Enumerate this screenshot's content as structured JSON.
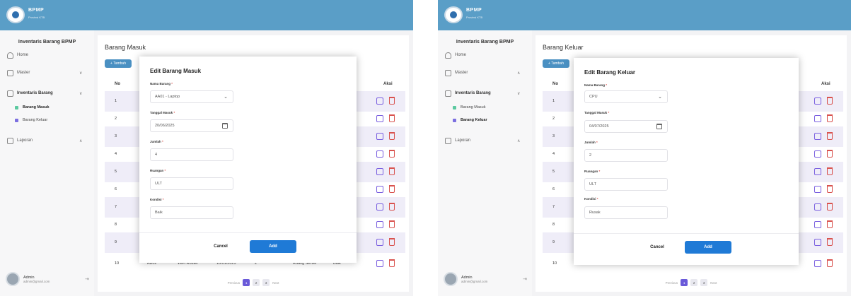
{
  "screens": [
    {
      "brand": "BPMP",
      "brand_sub": "Provinsi KTB",
      "sidebar": {
        "title": "Inventaris Barang BPMP",
        "home": "Home",
        "master": "Master",
        "master_chevron": "∨",
        "inventaris": "Inventaris Barang",
        "inventaris_chevron": "∨",
        "masuk": "Barang Masuk",
        "keluar": "Barang Keluar",
        "laporan": "Laporan",
        "laporan_chevron": "∧"
      },
      "user": {
        "name": "Admin",
        "email": "admin@gmail.com"
      },
      "main": {
        "page_title": "Barang Masuk",
        "add_label": "+ Tambah",
        "col_no": "No",
        "col_aksi": "Aksi",
        "rows": [
          "1",
          "2",
          "3",
          "4",
          "5",
          "6",
          "7",
          "8",
          "9",
          "10"
        ],
        "last_row": {
          "kode": "AB02",
          "nama": "WiFi Router",
          "tanggal": "10/01/2025",
          "jumlah": "2",
          "ruangan": "Ruang Server",
          "kondisi": "Baik"
        }
      },
      "pager": {
        "prev": "Previous",
        "pages": [
          "1",
          "2",
          "3"
        ],
        "next": "Next"
      },
      "modal": {
        "title": "Edit Barang Masuk",
        "nama_label": "Nama Barang",
        "nama_value": "AA01 - Laptop",
        "tanggal_label": "Tanggal Masuk",
        "tanggal_value": "20/06/2025",
        "jumlah_label": "Jumlah",
        "jumlah_value": "4",
        "ruangan_label": "Ruangan",
        "ruangan_value": "ULT",
        "kondisi_label": "Kondisi",
        "kondisi_value": "Baik",
        "cancel": "Cancel",
        "add": "Add"
      }
    },
    {
      "brand": "BPMP",
      "brand_sub": "Provinsi KTB",
      "sidebar": {
        "title": "Inventaris Barang BPMP",
        "home": "Home",
        "master": "Master",
        "master_chevron": "∧",
        "inventaris": "Inventaris Barang",
        "inventaris_chevron": "∨",
        "masuk": "Barang Masuk",
        "keluar": "Barang Keluar",
        "laporan": "Laporan",
        "laporan_chevron": "∧"
      },
      "user": {
        "name": "Admin",
        "email": "admin@gmail.com"
      },
      "main": {
        "page_title": "Barang Keluar",
        "add_label": "+ Tambah",
        "col_no": "No",
        "col_aksi": "Aksi",
        "rows": [
          "1",
          "2",
          "3",
          "4",
          "5",
          "6",
          "7",
          "8",
          "9",
          "10"
        ],
        "last_row": {
          "kode": "AB02",
          "nama": "WiFi Router",
          "tanggal": "15/01/2025",
          "jumlah": "2",
          "ruangan": "Ruang Server",
          "kondisi": "Rusak"
        }
      },
      "pager": {
        "prev": "Previous",
        "pages": [
          "1",
          "2",
          "3"
        ],
        "next": "Next"
      },
      "modal": {
        "title": "Edit Barang Keluar",
        "nama_label": "Nama Barang",
        "nama_value": "CPU",
        "tanggal_label": "Tanggal Masuk",
        "tanggal_value": "04/07/2025",
        "jumlah_label": "Jumlah",
        "jumlah_value": "2",
        "ruangan_label": "Ruangan",
        "ruangan_value": "ULT",
        "kondisi_label": "Kondisi",
        "kondisi_value": "Rusak",
        "cancel": "Cancel",
        "add": "Add"
      }
    }
  ],
  "colors": {
    "topbar": "#5a9ec7",
    "accent_purple": "#6a5ad9",
    "add_button": "#1f7ad6",
    "delete_red": "#d9534f",
    "edit_purple": "#7a5fe0",
    "row_alt": "#efedf8",
    "masuk_marker": "#5cc9a0",
    "keluar_marker": "#7b6ee0"
  },
  "icons": {
    "home": "home-icon",
    "master": "box-icon",
    "inventaris": "folder-icon",
    "laporan": "report-icon",
    "logout": "logout-icon",
    "edit": "edit-icon",
    "delete": "trash-icon",
    "calendar": "calendar-icon",
    "dropdown": "chevron-down-icon"
  },
  "required_mark": "*"
}
